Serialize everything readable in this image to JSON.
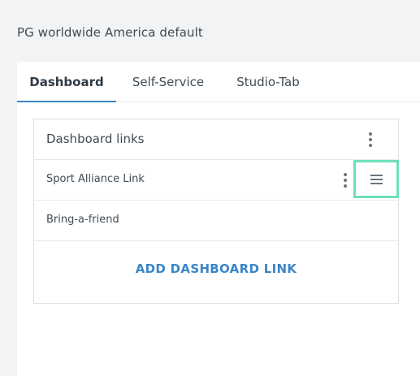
{
  "page": {
    "title": "PG worldwide America default"
  },
  "tabs": [
    {
      "label": "Dashboard",
      "active": true
    },
    {
      "label": "Self-Service",
      "active": false
    },
    {
      "label": "Studio-Tab",
      "active": false
    }
  ],
  "dashboard_links": {
    "title": "Dashboard links",
    "menu_icon": "kebab-menu-icon",
    "items": [
      {
        "label": "Sport Alliance Link",
        "menu_icon": "kebab-menu-icon",
        "handle_icon": "drag-handle-icon"
      },
      {
        "label": "Bring-a-friend"
      }
    ],
    "add_label": "ADD DASHBOARD LINK"
  },
  "colors": {
    "accent": "#3a86c8",
    "highlight": "#6ee0b8",
    "text": "#3f4b55",
    "background": "#f2f3f5"
  }
}
